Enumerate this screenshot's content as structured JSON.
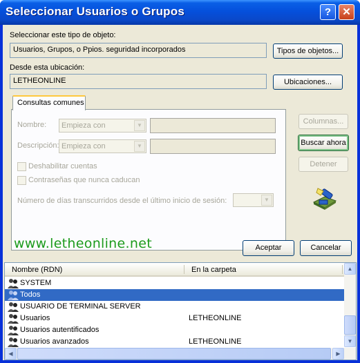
{
  "window": {
    "title": "Seleccionar Usuarios o Grupos",
    "help": "?",
    "close": "✕"
  },
  "object_type": {
    "label": "Seleccionar este tipo de objeto:",
    "value": "Usuarios, Grupos, o Ppios. seguridad incorporados",
    "button": "Tipos de objetos..."
  },
  "location": {
    "label": "Desde esta ubicación:",
    "value": "LETHEONLINE",
    "button": "Ubicaciones..."
  },
  "tab": {
    "label": "Consultas comunes"
  },
  "query": {
    "name_label": "Nombre:",
    "name_combo": "Empieza con",
    "desc_label": "Descripción:",
    "desc_combo": "Empieza con",
    "disabled_accounts": "Deshabilitar cuentas",
    "no_expire": "Contraseñas que nunca caducan",
    "days_label": "Número de días transcurridos desde el último inicio de sesión:"
  },
  "side_buttons": {
    "columns": "Columnas...",
    "search_now": "Buscar ahora",
    "stop": "Detener"
  },
  "watermark": "www.letheonline.net",
  "actions": {
    "ok": "Aceptar",
    "cancel": "Cancelar"
  },
  "results": {
    "columns": [
      "Nombre (RDN)",
      "En la carpeta"
    ],
    "rows": [
      {
        "name": "SYSTEM",
        "folder": ""
      },
      {
        "name": "Todos",
        "folder": ""
      },
      {
        "name": "USUARIO DE TERMINAL SERVER",
        "folder": ""
      },
      {
        "name": "Usuarios",
        "folder": "LETHEONLINE"
      },
      {
        "name": "Usuarios autentificados",
        "folder": ""
      },
      {
        "name": "Usuarios avanzados",
        "folder": "LETHEONLINE"
      }
    ],
    "selected_index": 1
  },
  "icons": {
    "title_help": "help-icon",
    "title_close": "close-icon",
    "search_graphic": "search-flashlight-icon",
    "group_icon": "user-group-icon"
  },
  "colors": {
    "titlebar": "#0a5fe6",
    "selection": "#316ac5",
    "watermark": "#1c9b1c"
  }
}
